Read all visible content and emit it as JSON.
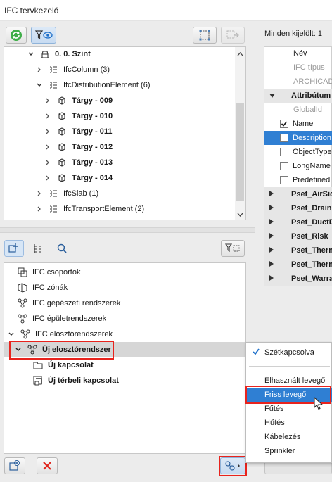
{
  "window": {
    "title": "IFC tervkezelő"
  },
  "colors": {
    "accent": "#2f7fd3",
    "highlight": "#e8231d",
    "selection_row": "#d6d6d6"
  },
  "top_tree": {
    "items": [
      {
        "label": "0. 0. Szint",
        "icon": "story-icon",
        "bold": true,
        "expanded": true
      },
      {
        "label": "IfcColumn (3)",
        "icon": "ifc-type-icon",
        "bold": false
      },
      {
        "label": "IfcDistributionElement (6)",
        "icon": "ifc-type-icon",
        "bold": false,
        "expanded": true
      },
      {
        "label": "Tárgy - 009",
        "icon": "object-icon",
        "bold": true
      },
      {
        "label": "Tárgy - 010",
        "icon": "object-icon",
        "bold": true
      },
      {
        "label": "Tárgy - 011",
        "icon": "object-icon",
        "bold": true
      },
      {
        "label": "Tárgy - 012",
        "icon": "object-icon",
        "bold": true
      },
      {
        "label": "Tárgy - 013",
        "icon": "object-icon",
        "bold": true
      },
      {
        "label": "Tárgy - 014",
        "icon": "object-icon",
        "bold": true
      },
      {
        "label": "IfcSlab (1)",
        "icon": "ifc-type-icon",
        "bold": false
      },
      {
        "label": "IfcTransportElement (2)",
        "icon": "ifc-type-icon",
        "bold": false
      }
    ]
  },
  "bottom_tree": {
    "items": [
      {
        "label": "IFC csoportok",
        "icon": "group-icon",
        "bold": false
      },
      {
        "label": "IFC zónák",
        "icon": "zone-icon",
        "bold": false
      },
      {
        "label": "IFC gépészeti rendszerek",
        "icon": "system-icon",
        "bold": false
      },
      {
        "label": "IFC épületrendszerek",
        "icon": "system-icon",
        "bold": false
      },
      {
        "label": "IFC elosztórendszerek",
        "icon": "system-icon",
        "bold": false,
        "expanded": true
      },
      {
        "label": "Új elosztórendszer",
        "icon": "system-icon",
        "bold": true,
        "expanded": true,
        "selected": true
      },
      {
        "label": "Új kapcsolat",
        "icon": "port-icon",
        "bold": true
      },
      {
        "label": "Új térbeli kapcsolat",
        "icon": "spatial-port-icon",
        "bold": true
      }
    ]
  },
  "right_panel": {
    "header": "Minden kijelölt: 1",
    "rows": [
      {
        "label": "Név",
        "kind": "field"
      },
      {
        "label": "IFC típus",
        "kind": "field-muted"
      },
      {
        "label": "ARCHICAD",
        "kind": "field-muted"
      },
      {
        "label": "Attribútum",
        "kind": "section-open"
      },
      {
        "label": "GlobalId",
        "kind": "field-muted"
      },
      {
        "label": "Name",
        "kind": "check-on"
      },
      {
        "label": "Description",
        "kind": "check-selected"
      },
      {
        "label": "ObjectType",
        "kind": "check-off"
      },
      {
        "label": "LongName",
        "kind": "check-off"
      },
      {
        "label": "Predefined",
        "kind": "check-off"
      },
      {
        "label": "Pset_AirSid",
        "kind": "section"
      },
      {
        "label": "Pset_Drain",
        "kind": "section"
      },
      {
        "label": "Pset_DuctD",
        "kind": "section"
      },
      {
        "label": "Pset_Risk",
        "kind": "section"
      },
      {
        "label": "Pset_Therm",
        "kind": "section"
      },
      {
        "label": "Pset_Therm",
        "kind": "section"
      },
      {
        "label": "Pset_Warra",
        "kind": "section"
      }
    ]
  },
  "popup_menu": {
    "items": [
      {
        "label": "Szétkapcsolva",
        "checked": true
      },
      {
        "label": "Elhasznált levegő"
      },
      {
        "label": "Friss levegő",
        "hover": true
      },
      {
        "label": "Fűtés"
      },
      {
        "label": "Hűtés"
      },
      {
        "label": "Kábelezés"
      },
      {
        "label": "Sprinkler"
      }
    ]
  }
}
